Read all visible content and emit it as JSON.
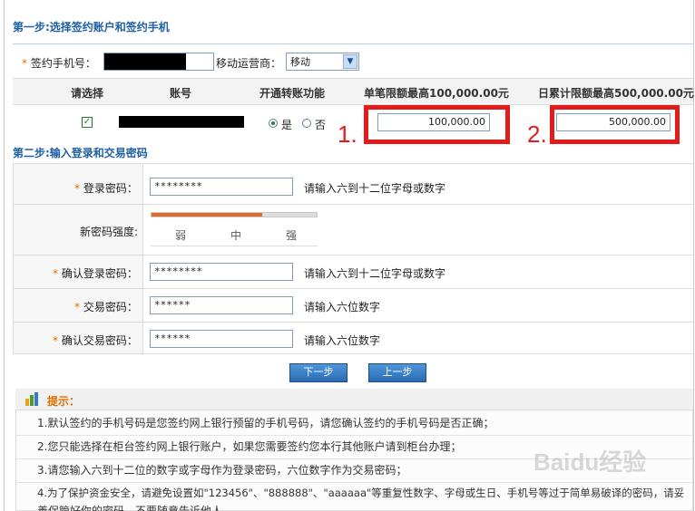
{
  "step1": {
    "title": "第一步:选择签约账户和签约手机",
    "phone_label": "签约手机号：",
    "carrier_label": "移动运营商：",
    "carrier_value": "移动",
    "columns": [
      "请选择",
      "账号",
      "开通转账功能",
      "单笔限额最高100,000.00元",
      "日累计限额最高500,000.00元"
    ],
    "transfer_yes": "是",
    "transfer_no": "否",
    "single_limit": "100,000.00",
    "daily_limit": "500,000.00"
  },
  "annotations": {
    "one": "1.",
    "two": "2."
  },
  "step2": {
    "title": "第二步:输入登录和交易密码",
    "login_pwd_label": "登录密码：",
    "login_pwd_value": "********",
    "login_pwd_hint": "请输入六到十二位字母或数字",
    "strength_label": "新密码强度:",
    "strength_levels": [
      "弱",
      "中",
      "强"
    ],
    "strength_fraction": 0.67,
    "confirm_login_label": "确认登录密码：",
    "confirm_login_value": "********",
    "confirm_login_hint": "请输入六到十二位字母或数字",
    "trade_pwd_label": "交易密码：",
    "trade_pwd_value": "******",
    "trade_pwd_hint": "请输入六位数字",
    "confirm_trade_label": "确认交易密码：",
    "confirm_trade_value": "******",
    "confirm_trade_hint": "请输入六位数字"
  },
  "buttons": {
    "next": "下一步",
    "prev": "上一步"
  },
  "tips": {
    "title": "提示：",
    "items": [
      "1.默认签约的手机号码是您签约网上银行预留的手机号码，请您确认签约的手机号码是否正确；",
      "2.您只能选择在柜台签约网上银行账户，如果您需要签约您本行其他账户请到柜台办理；",
      "3.请您输入六到十二位的数字或字母作为登录密码，六位数字作为交易密码；",
      "4.为了保护资金安全，请避免设置如\"123456\"、\"888888\"、\"aaaaaa\"等重复性数字、字母或生日、手机号等过于简单易破译的密码，请妥",
      "善保管好你的密码，不要随意告诉他人"
    ]
  },
  "watermark": "Baidu经验",
  "colors": {
    "accent": "#1f5fa3",
    "annotation": "#e41b1b",
    "strength": "#e06a2a"
  }
}
